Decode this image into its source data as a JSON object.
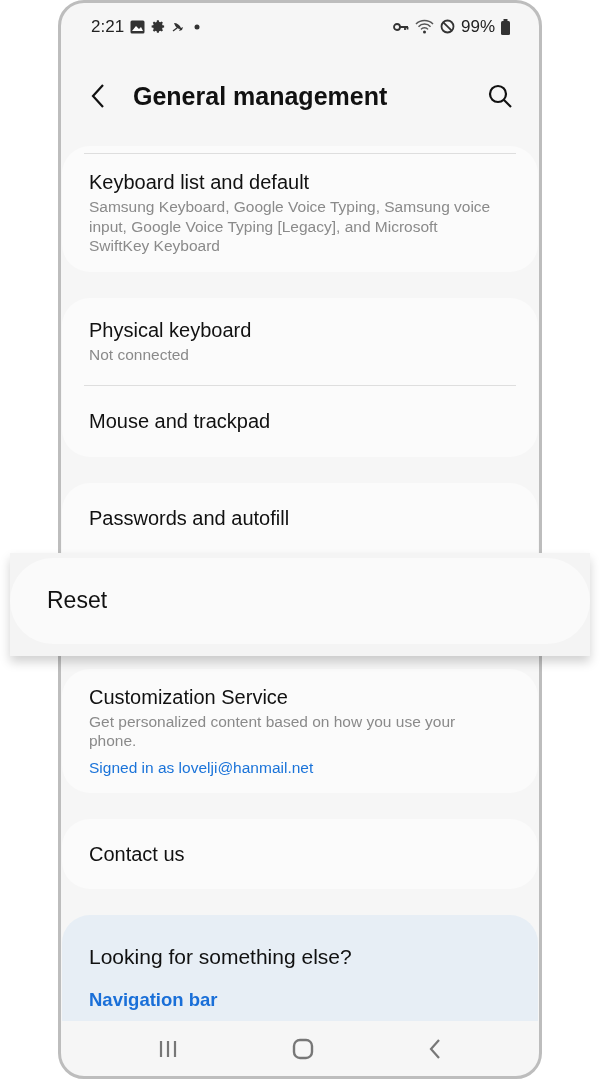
{
  "status_bar": {
    "time": "2:21",
    "battery": "99%"
  },
  "header": {
    "title": "General management"
  },
  "groups": [
    {
      "divider_top": true,
      "items": [
        {
          "kind": "normal",
          "title": "Keyboard list and default",
          "subtitle": "Samsung Keyboard, Google Voice Typing, Samsung voice input, Google Voice Typing [Legacy], and Microsoft SwiftKey Keyboard"
        }
      ]
    },
    {
      "items": [
        {
          "kind": "normal",
          "title": "Physical keyboard",
          "subtitle": "Not connected"
        },
        {
          "kind": "normal",
          "title": "Mouse and trackpad"
        }
      ]
    },
    {
      "items": [
        {
          "kind": "normal",
          "title": "Passwords and autofill"
        },
        {
          "kind": "highlighted",
          "title": "Reset"
        }
      ]
    },
    {
      "items": [
        {
          "kind": "normal",
          "title": "Customization Service",
          "subtitle": "Get personalized content based on how you use your phone.",
          "link": "Signed in as lovelji@hanmail.net"
        }
      ]
    },
    {
      "items": [
        {
          "kind": "normal",
          "title": "Contact us"
        }
      ]
    }
  ],
  "suggestions": {
    "title": "Looking for something else?",
    "links": [
      "Navigation bar"
    ]
  }
}
